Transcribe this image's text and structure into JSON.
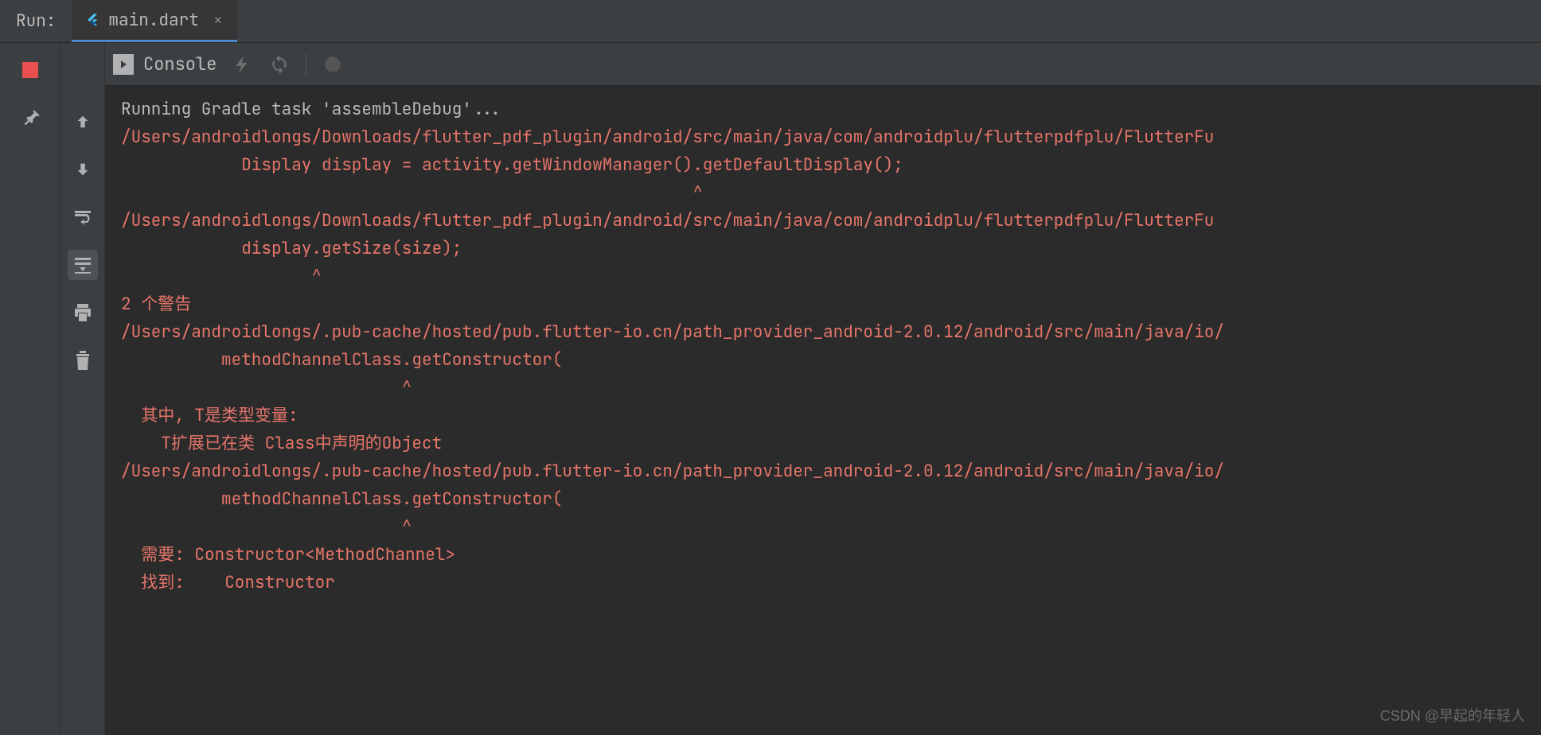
{
  "header": {
    "run_label": "Run:",
    "tab_label": "main.dart"
  },
  "console": {
    "label": "Console"
  },
  "output": {
    "lines": [
      {
        "cls": "line-normal",
        "text": "Running Gradle task 'assembleDebug'..."
      },
      {
        "cls": "line-error",
        "text": "/Users/androidlongs/Downloads/flutter_pdf_plugin/android/src/main/java/com/androidplu/flutterpdfplu/FlutterFu"
      },
      {
        "cls": "line-error",
        "text": "            Display display = activity.getWindowManager().getDefaultDisplay();"
      },
      {
        "cls": "line-error",
        "text": "                                                         ^"
      },
      {
        "cls": "line-error",
        "text": "/Users/androidlongs/Downloads/flutter_pdf_plugin/android/src/main/java/com/androidplu/flutterpdfplu/FlutterFu"
      },
      {
        "cls": "line-error",
        "text": "            display.getSize(size);"
      },
      {
        "cls": "line-error",
        "text": "                   ^"
      },
      {
        "cls": "line-error",
        "text": "2 个警告"
      },
      {
        "cls": "line-error",
        "text": "/Users/androidlongs/.pub-cache/hosted/pub.flutter-io.cn/path_provider_android-2.0.12/android/src/main/java/io/"
      },
      {
        "cls": "line-error",
        "text": "          methodChannelClass.getConstructor("
      },
      {
        "cls": "line-error",
        "text": "                            ^"
      },
      {
        "cls": "line-error",
        "text": "  其中, T是类型变量:"
      },
      {
        "cls": "line-error",
        "text": "    T扩展已在类 Class中声明的Object"
      },
      {
        "cls": "line-error",
        "text": "/Users/androidlongs/.pub-cache/hosted/pub.flutter-io.cn/path_provider_android-2.0.12/android/src/main/java/io/"
      },
      {
        "cls": "line-error",
        "text": "          methodChannelClass.getConstructor("
      },
      {
        "cls": "line-error",
        "text": "                            ^"
      },
      {
        "cls": "line-error",
        "text": "  需要: Constructor<MethodChannel>"
      },
      {
        "cls": "line-error",
        "text": "  找到:    Constructor"
      }
    ]
  },
  "watermark": "CSDN @早起的年轻人"
}
